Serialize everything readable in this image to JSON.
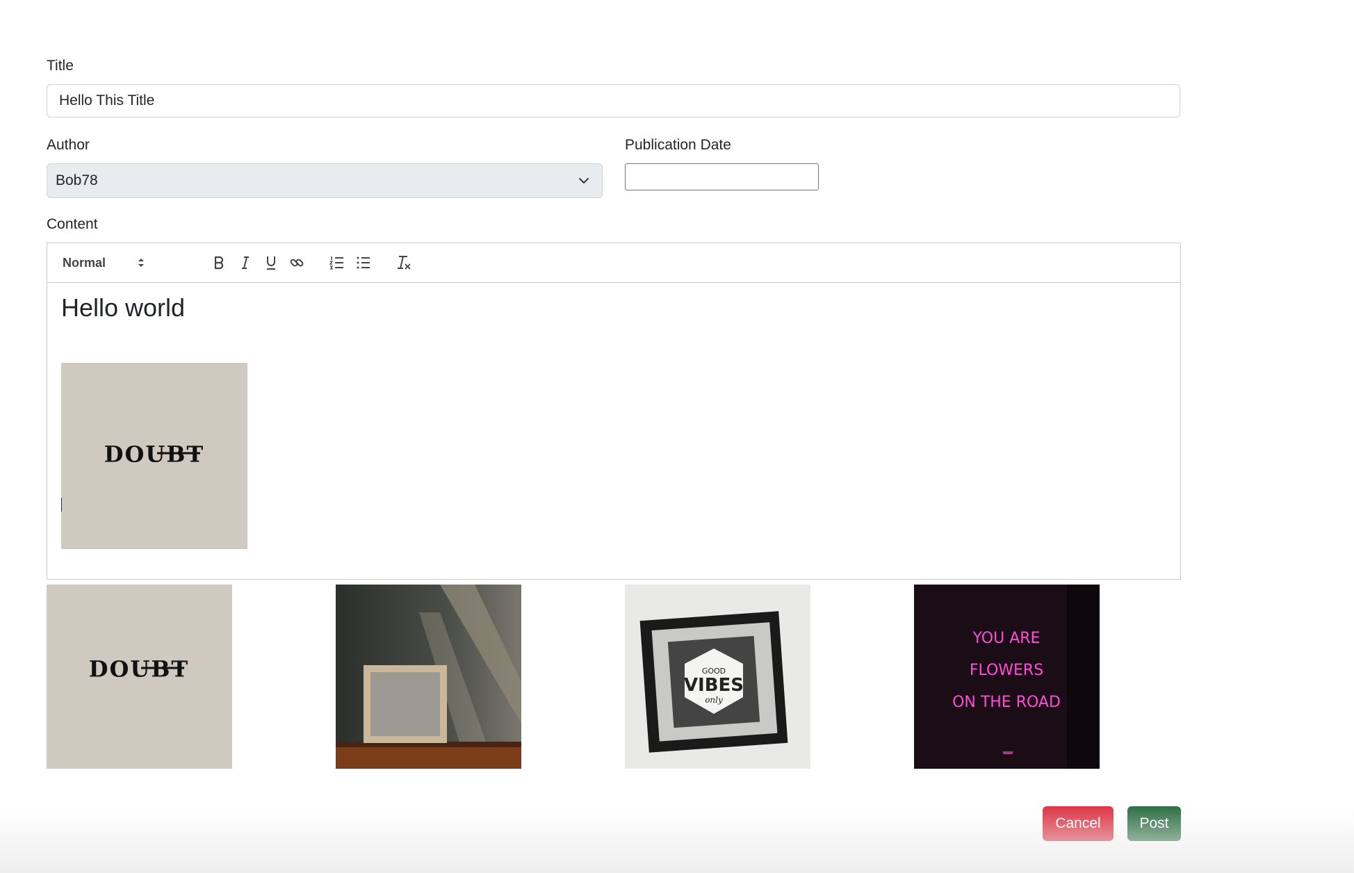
{
  "form": {
    "title_label": "Title",
    "title_value": "Hello This Title",
    "author_label": "Author",
    "author_selected": "Bob78",
    "date_label": "Publication Date",
    "date_value": "",
    "content_label": "Content"
  },
  "editor": {
    "format_select": "Normal",
    "toolbar_icons": [
      "bold-icon",
      "italic-icon",
      "underline-icon",
      "link-icon",
      "ordered-list-icon",
      "bullet-list-icon",
      "clear-format-icon"
    ],
    "heading_text": "Hello world",
    "embedded_image": {
      "word": "DOUBT"
    }
  },
  "gallery": [
    {
      "name": "doubt",
      "text": "DOUBT"
    },
    {
      "name": "empty-frame-on-shelf"
    },
    {
      "name": "good-vibes-frame",
      "text_top": "GOOD",
      "text_main": "VIBES",
      "text_bottom": "only"
    },
    {
      "name": "neon-sign",
      "lines": [
        "YOU ARE",
        "FLOWERS",
        "ON THE ROAD"
      ]
    }
  ],
  "actions": {
    "cancel": "Cancel",
    "post": "Post"
  },
  "colors": {
    "cancel": "#dc3545",
    "post": "#2f6f45",
    "select_bg": "#e9ecef",
    "doubt_bg": "#d0c9bf",
    "neon": "#ff4dd8"
  }
}
